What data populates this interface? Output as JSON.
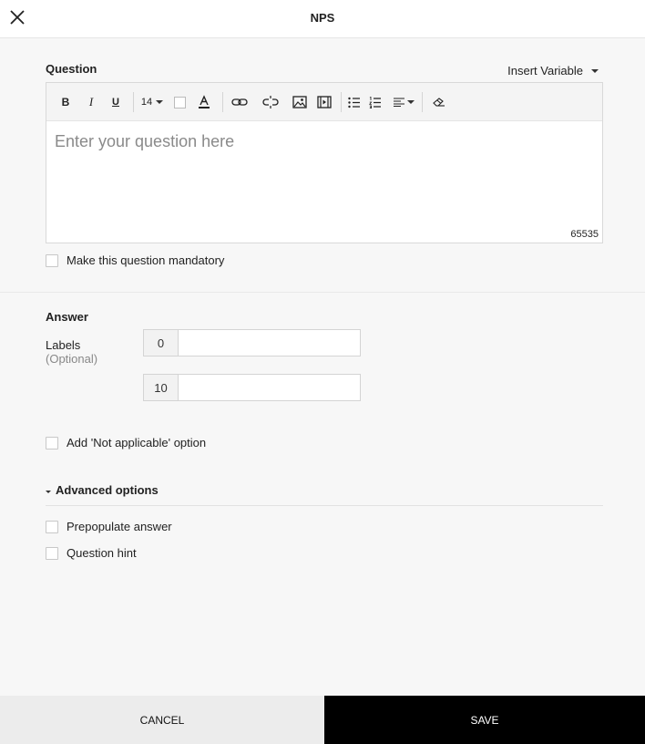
{
  "header": {
    "title": "NPS",
    "close_icon": "close-icon"
  },
  "question": {
    "label": "Question",
    "insert_variable": "Insert Variable",
    "toolbar": {
      "bold": "B",
      "italic": "I",
      "underline": "U",
      "font_size": "14"
    },
    "placeholder": "Enter your question here",
    "char_count": "65535",
    "mandatory_label": "Make this question mandatory"
  },
  "answer": {
    "label": "Answer",
    "labels_label": "Labels",
    "optional_label": "(Optional)",
    "min_prefix": "0",
    "min_value": "",
    "max_prefix": "10",
    "max_value": "",
    "not_applicable_label": "Add 'Not applicable' option"
  },
  "advanced": {
    "label": "Advanced options",
    "prepopulate_label": "Prepopulate answer",
    "hint_label": "Question hint"
  },
  "footer": {
    "cancel_label": "CANCEL",
    "save_label": "SAVE"
  },
  "colors": {
    "save_bg": "#000000",
    "cancel_bg": "#ececec",
    "page_bg": "#f7f7f7"
  }
}
